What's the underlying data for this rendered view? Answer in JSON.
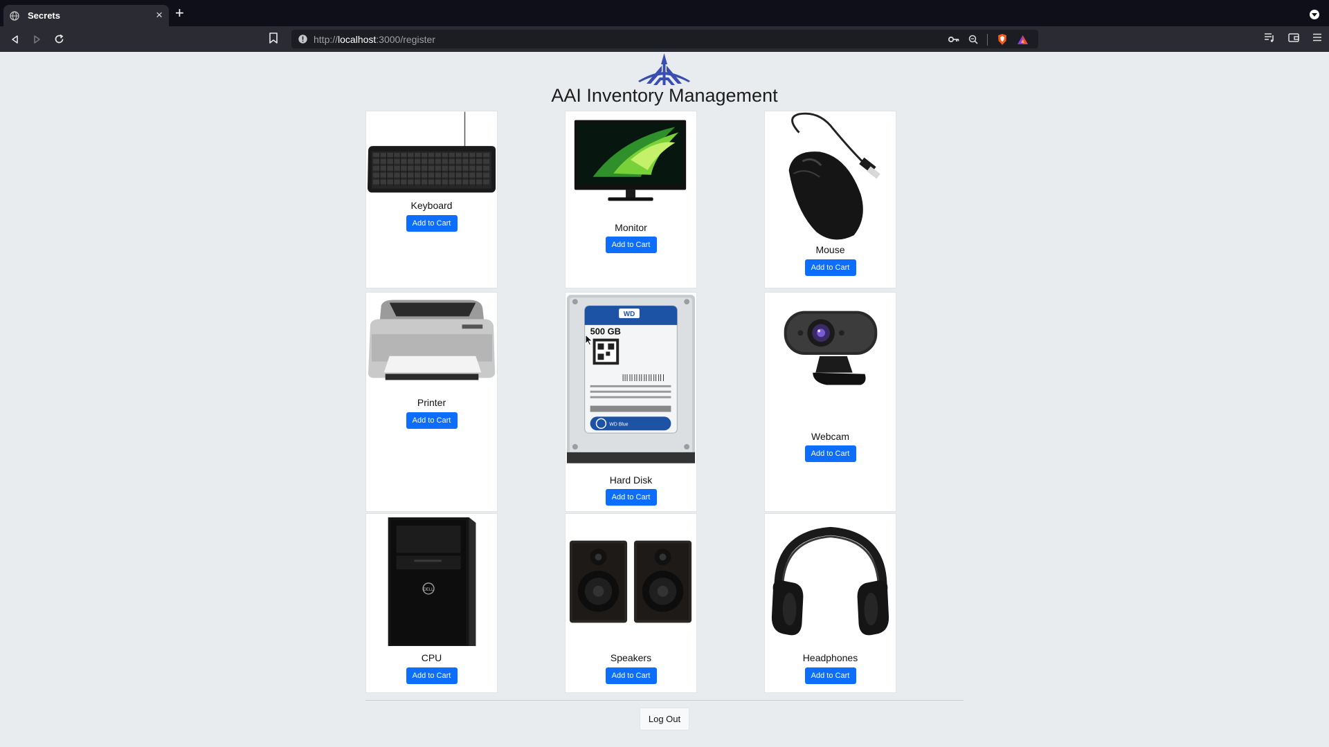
{
  "browser": {
    "tab_title": "Secrets",
    "tab_close": "×",
    "new_tab": "+",
    "url_scheme": "http://",
    "url_host": "localhost",
    "url_path": ":3000/register"
  },
  "page": {
    "title": "AAI Inventory Management",
    "logout_label": "Log Out"
  },
  "products": [
    {
      "name": "Keyboard",
      "button": "Add to Cart",
      "icon": "keyboard-image"
    },
    {
      "name": "Monitor",
      "button": "Add to Cart",
      "icon": "monitor-image"
    },
    {
      "name": "Mouse",
      "button": "Add to Cart",
      "icon": "mouse-image"
    },
    {
      "name": "Printer",
      "button": "Add to Cart",
      "icon": "printer-image"
    },
    {
      "name": "Hard Disk",
      "button": "Add to Cart",
      "icon": "hard-disk-image"
    },
    {
      "name": "Webcam",
      "button": "Add to Cart",
      "icon": "webcam-image"
    },
    {
      "name": "CPU",
      "button": "Add to Cart",
      "icon": "cpu-tower-image"
    },
    {
      "name": "Speakers",
      "button": "Add to Cart",
      "icon": "speakers-image"
    },
    {
      "name": "Headphones",
      "button": "Add to Cart",
      "icon": "headphones-image"
    }
  ],
  "hard_disk_label": {
    "brand": "WD",
    "capacity": "500 GB",
    "series": "WD Blue"
  },
  "colors": {
    "primary_button": "#0d6efd",
    "page_background": "#e9ecef",
    "logo_blue": "#3a4db0"
  }
}
